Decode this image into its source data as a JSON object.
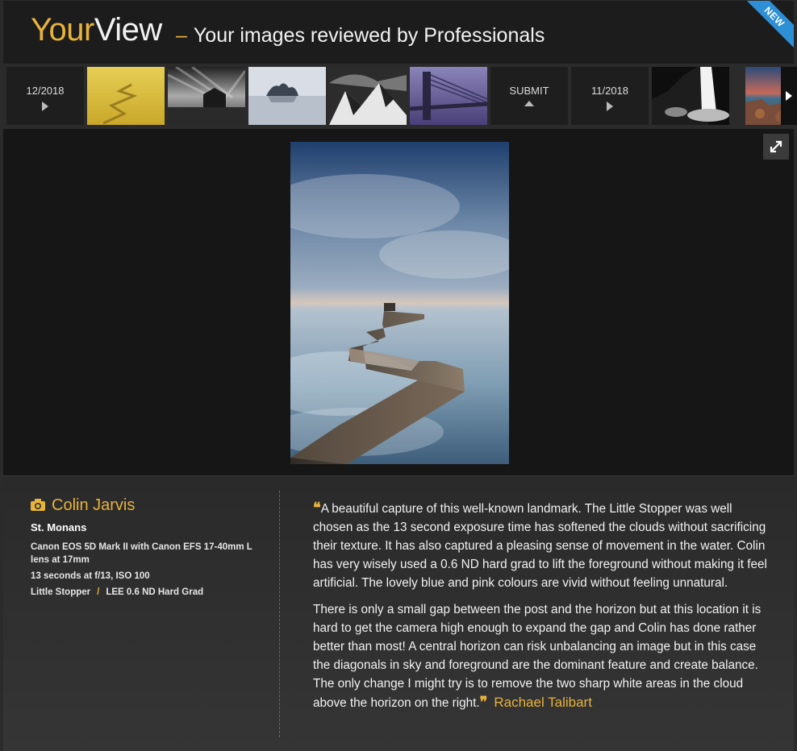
{
  "header": {
    "logo_part1": "Your",
    "logo_part2": "View",
    "dash": "–",
    "tagline": "Your images reviewed by Professionals",
    "ribbon": "NEW"
  },
  "strip": {
    "current_month": "12/2018",
    "submit_label": "SUBMIT",
    "previous_month": "11/2018"
  },
  "photo": {
    "author": "Colin Jarvis",
    "location": "St. Monans",
    "camera_line": "Canon EOS 5D Mark II with Canon EFS 17-40mm L lens at 17mm",
    "exposure_line": "13 seconds at f/13, ISO 100",
    "filter_a": "Little Stopper",
    "filter_sep": "/",
    "filter_b": "LEE 0.6 ND Hard Grad"
  },
  "review": {
    "paragraph1": "A beautiful capture of this well-known landmark. The Little Stopper was well chosen as the 13 second exposure time has softened the clouds without sacrificing their texture. It has also captured a pleasing sense of movement in the water. Colin has very wisely used a 0.6 ND hard grad to lift the foreground without making it feel artificial. The lovely blue and pink colours are vivid without feeling unnatural.",
    "paragraph2": "There is only a small gap between the post and the horizon but at this location it is hard to get the camera high enough to expand the gap and Colin has done rather better than most! A central horizon can risk unbalancing an image but in this case the diagonals in sky and foreground are the dominant feature and create balance. The only change I might try is to remove the two sharp white areas in the cloud above the horizon on the right.",
    "open_quote": "❝",
    "close_quote": "❞",
    "reviewer": "Rachael Talibart"
  },
  "icons": {
    "camera": "camera-icon",
    "expand": "expand-icon",
    "next": "chevron-right-icon"
  },
  "colors": {
    "accent": "#e8b33a",
    "ribbon": "#2d8fd6",
    "background": "#161616"
  }
}
